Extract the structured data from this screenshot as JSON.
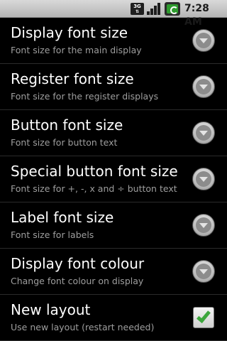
{
  "status_bar": {
    "network_label": "3G",
    "time": "7:28",
    "meridiem": "AM",
    "icons": [
      "3g-data-icon",
      "signal-strength-icon",
      "battery-charging-icon"
    ]
  },
  "preferences": [
    {
      "title": "Display font size",
      "summary": "Font size for the main display",
      "widget": "dropdown-arrow"
    },
    {
      "title": "Register font size",
      "summary": "Font size for the register displays",
      "widget": "dropdown-arrow"
    },
    {
      "title": "Button font size",
      "summary": "Font size for button text",
      "widget": "dropdown-arrow"
    },
    {
      "title": "Special button font size",
      "summary": "Font size for +, -, x and ÷ button text",
      "widget": "dropdown-arrow"
    },
    {
      "title": "Label font size",
      "summary": "Font size for labels",
      "widget": "dropdown-arrow"
    },
    {
      "title": "Display font colour",
      "summary": "Change font colour on display",
      "widget": "dropdown-arrow"
    },
    {
      "title": "New layout",
      "summary": "Use new layout (restart needed)",
      "widget": "checkbox",
      "checked": true
    }
  ],
  "colors": {
    "background": "#000000",
    "summary_text": "#9e9e9e",
    "checkmark": "#3da63d",
    "divider": "#2b2b2b"
  }
}
